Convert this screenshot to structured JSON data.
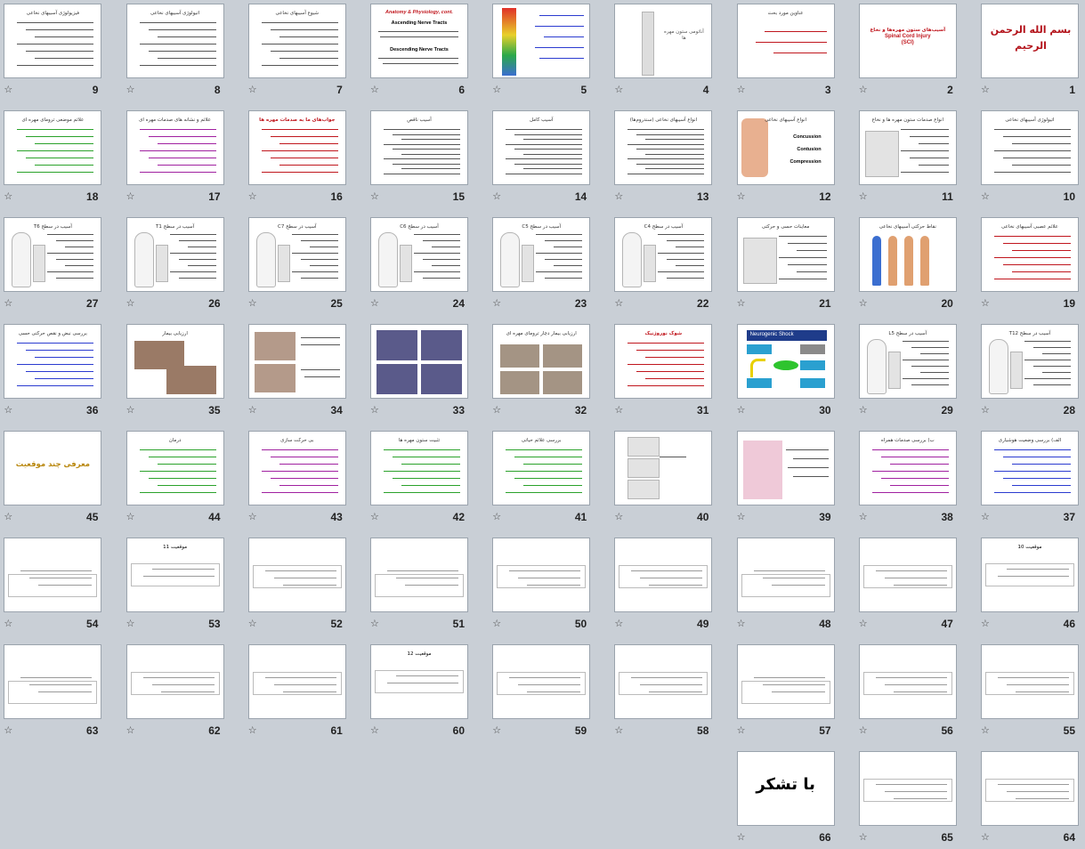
{
  "view": "slide-sorter",
  "slide_numbers": [
    "1",
    "2",
    "3",
    "4",
    "5",
    "6",
    "7",
    "8",
    "9",
    "10",
    "11",
    "12",
    "13",
    "14",
    "15",
    "16",
    "17",
    "18",
    "19",
    "20",
    "21",
    "22",
    "23",
    "24",
    "25",
    "26",
    "27",
    "28",
    "29",
    "30",
    "31",
    "32",
    "33",
    "34",
    "35",
    "36",
    "37",
    "38",
    "39",
    "40",
    "41",
    "42",
    "43",
    "44",
    "45",
    "46",
    "47",
    "48",
    "49",
    "50",
    "51",
    "52",
    "53",
    "54",
    "55",
    "56",
    "57",
    "58",
    "59",
    "60",
    "61",
    "62",
    "63",
    "64",
    "65",
    "66"
  ],
  "transition_icon": "star-icon",
  "slides_text": {
    "s1_calligraphy": "بسم الله الرحمن الرحیم",
    "s2_title_fa": "آسیب‌های ستون مهره‌ها و نخاع",
    "s2_title_en": "Spinal Cord Injury",
    "s2_title_abbr": "(SCI)",
    "s3_title": "عناوین مورد بحث",
    "s4_title": "آناتومی ستون مهره ها",
    "s6_title_1": "Anatomy & Physiology, cont.",
    "s6_title_2": "Ascending Nerve Tracts",
    "s6_title_3": "Descending Nerve Tracts",
    "s7_title": "شیوع آسیبهای نخاعی",
    "s8_title": "اتیولوژی آسیبهای نخاعی",
    "s9_title": "فیزیولوژی آسیبهای نخاعی",
    "s10_title": "اتیولوژی آسیبهای نخاعی",
    "s11_title": "انواع صدمات ستون مهره ها و نخاع",
    "s12_title": "انواع آسیبهای نخاعی",
    "s12_items": [
      "Concussion",
      "Contusion",
      "Compression"
    ],
    "s13_title": "انواع آسیبهای نخاعی (سندروم‌ها)",
    "s14_title": "آسیب کامل",
    "s15_title": "آسیب ناقص",
    "s16_title": "جواب‌های ما به صدمات مهره ها",
    "s17_title": "علائم و نشانه های صدمات مهره ای",
    "s18_title": "علائم موضعی ترومای مهره ای",
    "s19_title": "علائم عصبی آسیبهای نخاعی",
    "s20_title": "نقاط حرکتی آسیبهای نخاعی",
    "s21_title": "معاینات حسی و حرکتی",
    "s22_title": "آسیب در سطح C4",
    "s23_title": "آسیب در سطح C5",
    "s24_title": "آسیب در سطح C6",
    "s25_title": "آسیب در سطح C7",
    "s26_title": "آسیب در سطح T1",
    "s27_title": "آسیب در سطح T6",
    "s28_title": "آسیب در سطح T12",
    "s29_title": "آسیب در سطح L5",
    "s30_title": "Neurogenic Shock",
    "s31_title": "شوک نوروژنیک",
    "s32_title": "ارزیابی بیمار دچار ترومای مهره ای",
    "s35_title": "ارزیابی بیمار",
    "s36_title": "بررسی نبض و نقص حرکتی حسی",
    "s37_title": "الف) بررسی وضعیت هوشیاری",
    "s38_title": "ب) بررسی صدمات همراه",
    "s41_title": "بررسی علائم حیاتی",
    "s42_title": "تثبیت ستون مهره ها",
    "s43_title": "بی حرکت سازی",
    "s44_title": "درمان",
    "s45_title": "معرفی چند موقعیت",
    "s46_title": "موقعیت 10",
    "s53_title": "موقعیت 11",
    "s60_title": "موقعیت 12",
    "s66_title": "با تشکر"
  },
  "colors": {
    "background": "#c9cfd6",
    "slide_border": "#9aa3ad",
    "accent_red": "#c0161d",
    "accent_green": "#2aa22a",
    "accent_purple": "#a020a0",
    "accent_blue": "#2b3bd0",
    "accent_gold": "#b8860b"
  }
}
